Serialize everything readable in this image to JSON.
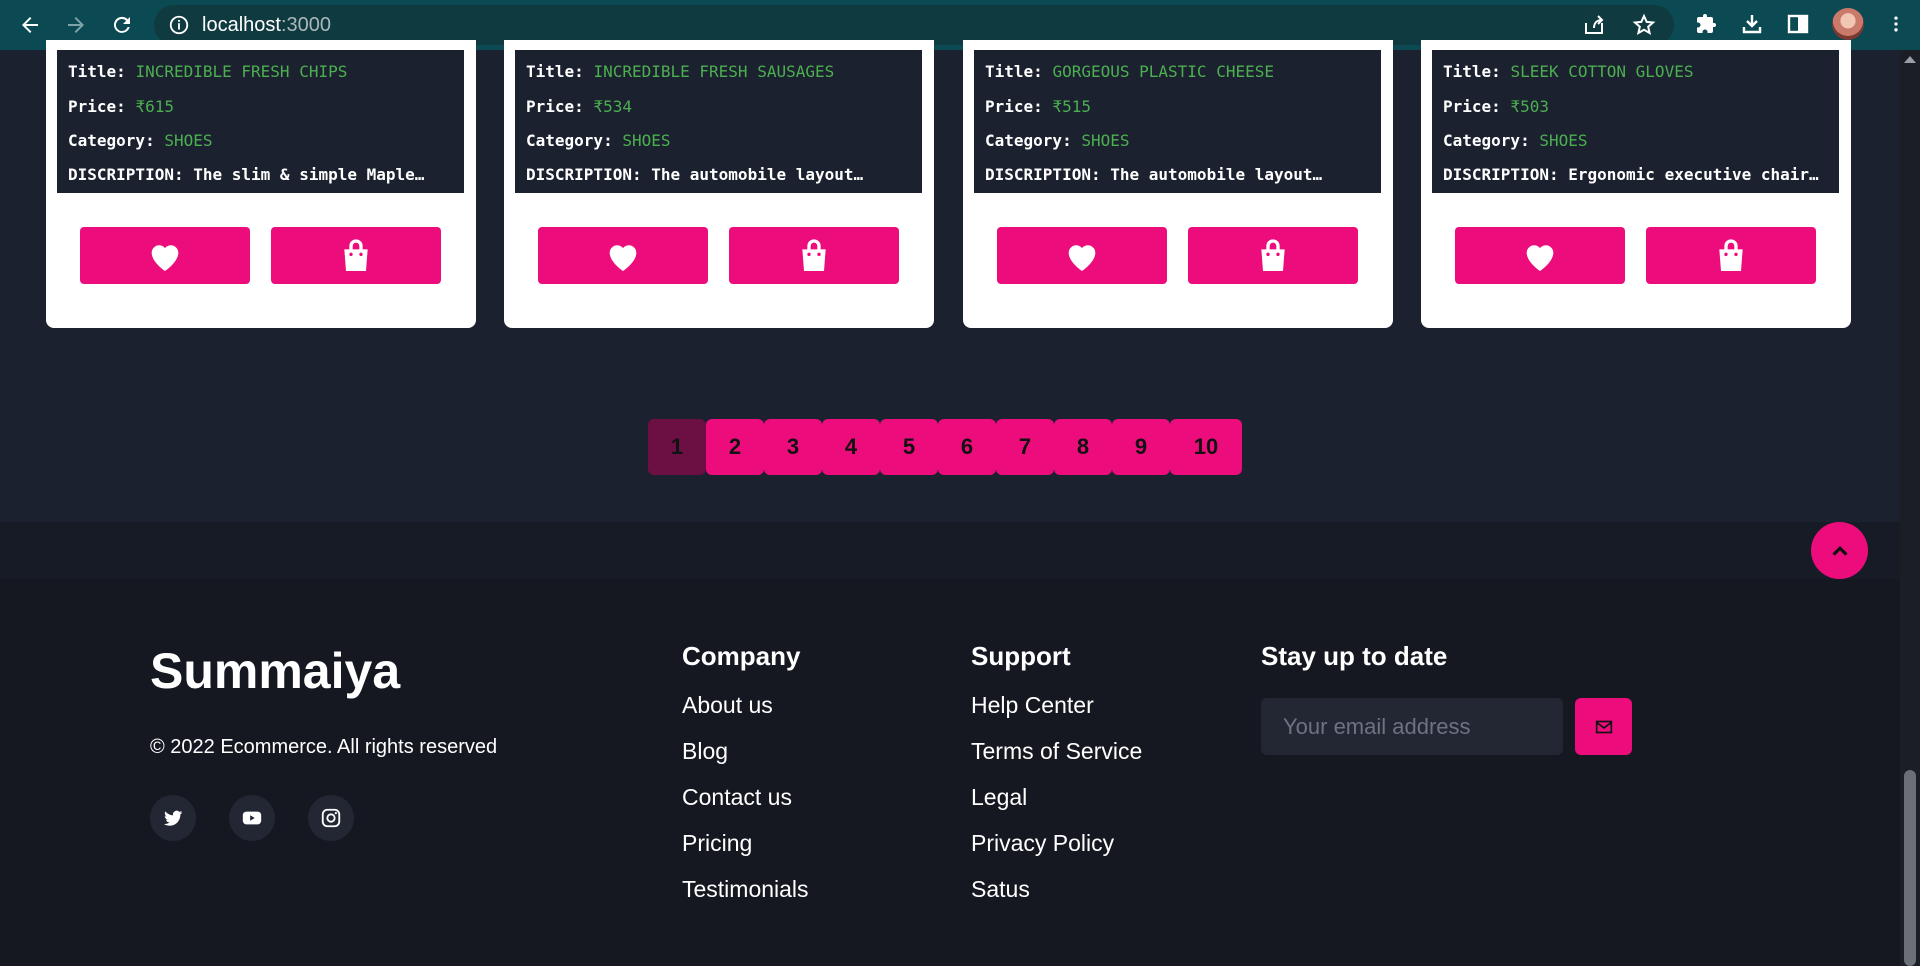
{
  "browser": {
    "url_host": "localhost",
    "url_port": ":3000",
    "icons": [
      "back-icon",
      "forward-icon",
      "reload-icon",
      "info-icon",
      "share-icon",
      "star-icon",
      "extensions-icon",
      "download-icon",
      "sidepanel-icon",
      "profile-avatar",
      "menu-icon"
    ]
  },
  "labels": {
    "title": "Title:",
    "price": "Price:",
    "category": "Category:",
    "description": "DISCRIPTION:"
  },
  "products": [
    {
      "title": "INCREDIBLE FRESH CHIPS",
      "price": "₹615",
      "category": "SHOES",
      "description": "The slim & simple Maple…"
    },
    {
      "title": "INCREDIBLE FRESH SAUSAGES",
      "price": "₹534",
      "category": "SHOES",
      "description": "The automobile layout…"
    },
    {
      "title": "GORGEOUS PLASTIC CHEESE",
      "price": "₹515",
      "category": "SHOES",
      "description": "The automobile layout…"
    },
    {
      "title": "SLEEK COTTON GLOVES",
      "price": "₹503",
      "category": "SHOES",
      "description": "Ergonomic executive chair…"
    }
  ],
  "pagination": {
    "current": 1,
    "pages": [
      "1",
      "2",
      "3",
      "4",
      "5",
      "6",
      "7",
      "8",
      "9",
      "10"
    ]
  },
  "footer": {
    "brand": "Summaiya",
    "copyright": "© 2022 Ecommerce. All rights reserved",
    "socials": [
      "twitter-icon",
      "youtube-icon",
      "instagram-icon"
    ],
    "company": {
      "heading": "Company",
      "links": [
        "About us",
        "Blog",
        "Contact us",
        "Pricing",
        "Testimonials"
      ]
    },
    "support": {
      "heading": "Support",
      "links": [
        "Help Center",
        "Terms of Service",
        "Legal",
        "Privacy Policy",
        "Satus"
      ]
    },
    "newsletter": {
      "heading": "Stay up to date",
      "placeholder": "Your email address"
    }
  },
  "colors": {
    "accent": "#ec0c7b",
    "accent_active": "#6c1043",
    "value_green": "#4caf50",
    "page_bg": "#1b212f",
    "footer_bg": "#151821",
    "chrome_bg": "#0b4a52"
  }
}
